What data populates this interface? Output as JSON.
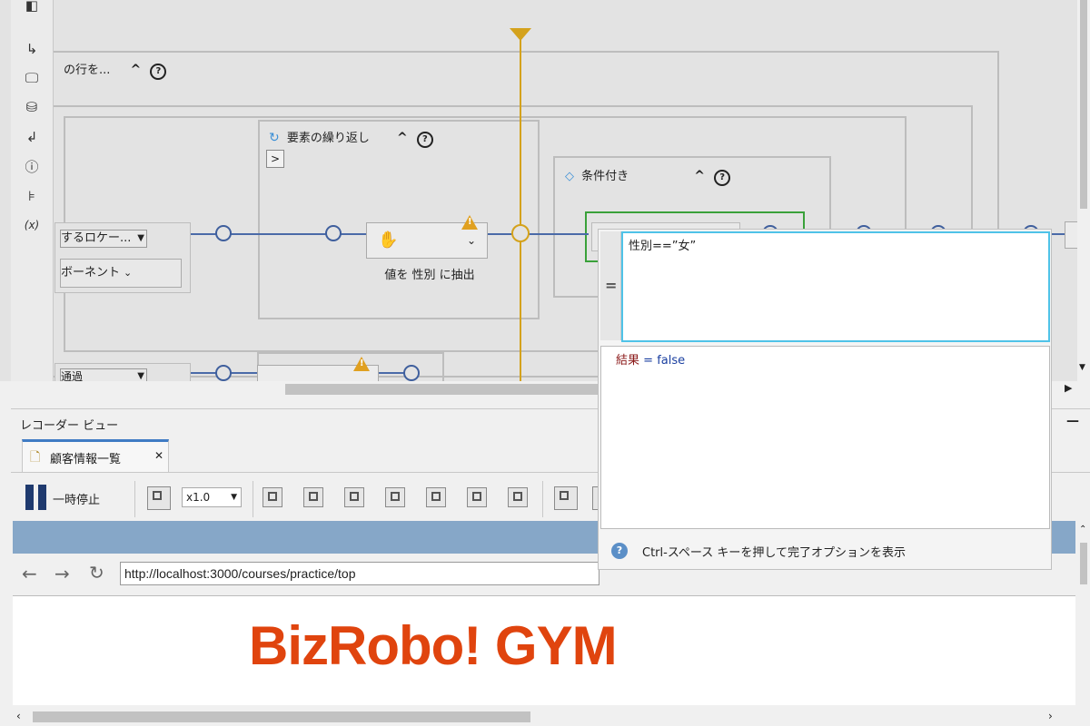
{
  "designer": {
    "loop_rows_title": "の行を...",
    "repeat_title": "要素の繰り返し",
    "condition_title": "条件付き",
    "locator_select": "するロケー...",
    "component_select": "ボーネント",
    "extract_step_label": "値を 性別 に抽出",
    "bottom_select": "通過",
    "collapse_glyph": "^",
    "help_glyph": "?",
    "expand_glyph": ">"
  },
  "expression_editor": {
    "expression": "性別==”女”",
    "equals_glyph": "=",
    "result_label": "結果",
    "result_eq": " = ",
    "result_value": "false",
    "hint": "Ctrl-スペース キーを押して完了オプションを表示"
  },
  "recorder": {
    "panel_title": "レコーダー ビュー",
    "minimize_glyph": "—",
    "tab_label": "顧客情報一覧",
    "tab_close": "✕",
    "pause_label": "一時停止",
    "speed_value": "x1.0",
    "url": "http://localhost:3000/courses/practice/top",
    "logo_text": "BizRobo! GYM"
  },
  "colors": {
    "accent_blue": "#3f5f9d",
    "guide_yellow": "#d4a21c",
    "condition_green": "#3aa13a",
    "logo_orange": "#e0440e",
    "focus_cyan": "#4fc3e8",
    "browser_bar": "#86a7c8"
  }
}
